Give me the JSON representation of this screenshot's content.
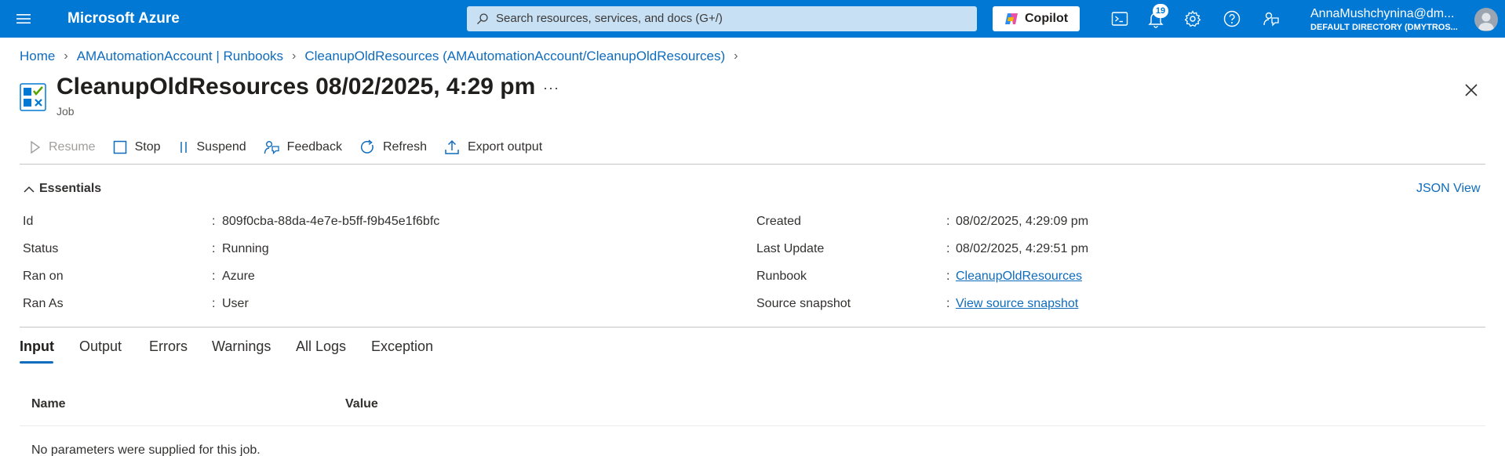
{
  "topbar": {
    "brand": "Microsoft Azure",
    "search_placeholder": "Search resources, services, and docs (G+/)",
    "copilot_label": "Copilot",
    "notification_count": "19",
    "user_name": "AnnaMushchynina@dm...",
    "user_directory": "DEFAULT DIRECTORY (DMYTROS...",
    "icons": [
      "menu-icon",
      "search-icon",
      "copilot-icon",
      "cloud-shell-icon",
      "bell-icon",
      "gear-icon",
      "help-icon",
      "feedback-icon",
      "avatar"
    ]
  },
  "breadcrumb": {
    "items": [
      "Home",
      "AMAutomationAccount | Runbooks",
      "CleanupOldResources (AMAutomationAccount/CleanupOldResources)"
    ]
  },
  "header": {
    "title": "CleanupOldResources 08/02/2025, 4:29 pm",
    "more": "···",
    "subtitle": "Job"
  },
  "toolbar": {
    "resume": "Resume",
    "stop": "Stop",
    "suspend": "Suspend",
    "feedback": "Feedback",
    "refresh": "Refresh",
    "export": "Export output"
  },
  "essentials": {
    "title": "Essentials",
    "json_view": "JSON View",
    "left": [
      {
        "label": "Id",
        "value": "809f0cba-88da-4e7e-b5ff-f9b45e1f6bfc"
      },
      {
        "label": "Status",
        "value": "Running"
      },
      {
        "label": "Ran on",
        "value": "Azure"
      },
      {
        "label": "Ran As",
        "value": "User"
      }
    ],
    "right": [
      {
        "label": "Created",
        "value": "08/02/2025, 4:29:09 pm"
      },
      {
        "label": "Last Update",
        "value": "08/02/2025, 4:29:51 pm"
      },
      {
        "label": "Runbook",
        "value": "CleanupOldResources"
      },
      {
        "label": "Source snapshot",
        "value": "View source snapshot"
      }
    ]
  },
  "tabs": [
    "Input",
    "Output",
    "Errors",
    "Warnings",
    "All Logs",
    "Exception"
  ],
  "active_tab": "Input",
  "table": {
    "columns": [
      "Name",
      "Value"
    ],
    "empty_message": "No parameters were supplied for this job."
  },
  "colors": {
    "topbar": "#0078d4",
    "link": "#0f6cbd",
    "search_bg": "#c7e0f4"
  }
}
